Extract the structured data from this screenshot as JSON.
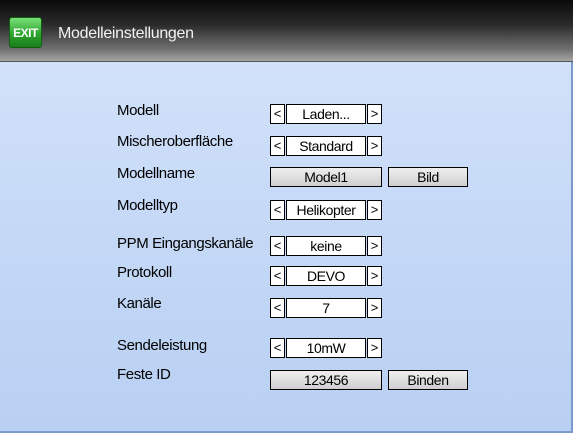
{
  "header": {
    "exit_label": "EXIT",
    "title": "Modelleinstellungen"
  },
  "rows": {
    "modell": {
      "label": "Modell",
      "value": "Laden..."
    },
    "mischer": {
      "label": "Mischeroberfläche",
      "value": "Standard"
    },
    "modellname": {
      "label": "Modellname",
      "value": "Model1",
      "button": "Bild"
    },
    "modelltyp": {
      "label": "Modelltyp",
      "value": "Helikopter"
    },
    "ppm": {
      "label": "PPM Eingangskanäle",
      "value": "keine"
    },
    "protokoll": {
      "label": "Protokoll",
      "value": "DEVO"
    },
    "kanaele": {
      "label": "Kanäle",
      "value": "7"
    },
    "sendeleistung": {
      "label": "Sendeleistung",
      "value": "10mW"
    },
    "festeid": {
      "label": "Feste ID",
      "value": "123456",
      "button": "Binden"
    }
  },
  "arrows": {
    "left": "<",
    "right": ">"
  },
  "colors": {
    "background": "#c7daf7",
    "exit_button": "#2ca52c",
    "title_bar": "#2a2a2a"
  }
}
